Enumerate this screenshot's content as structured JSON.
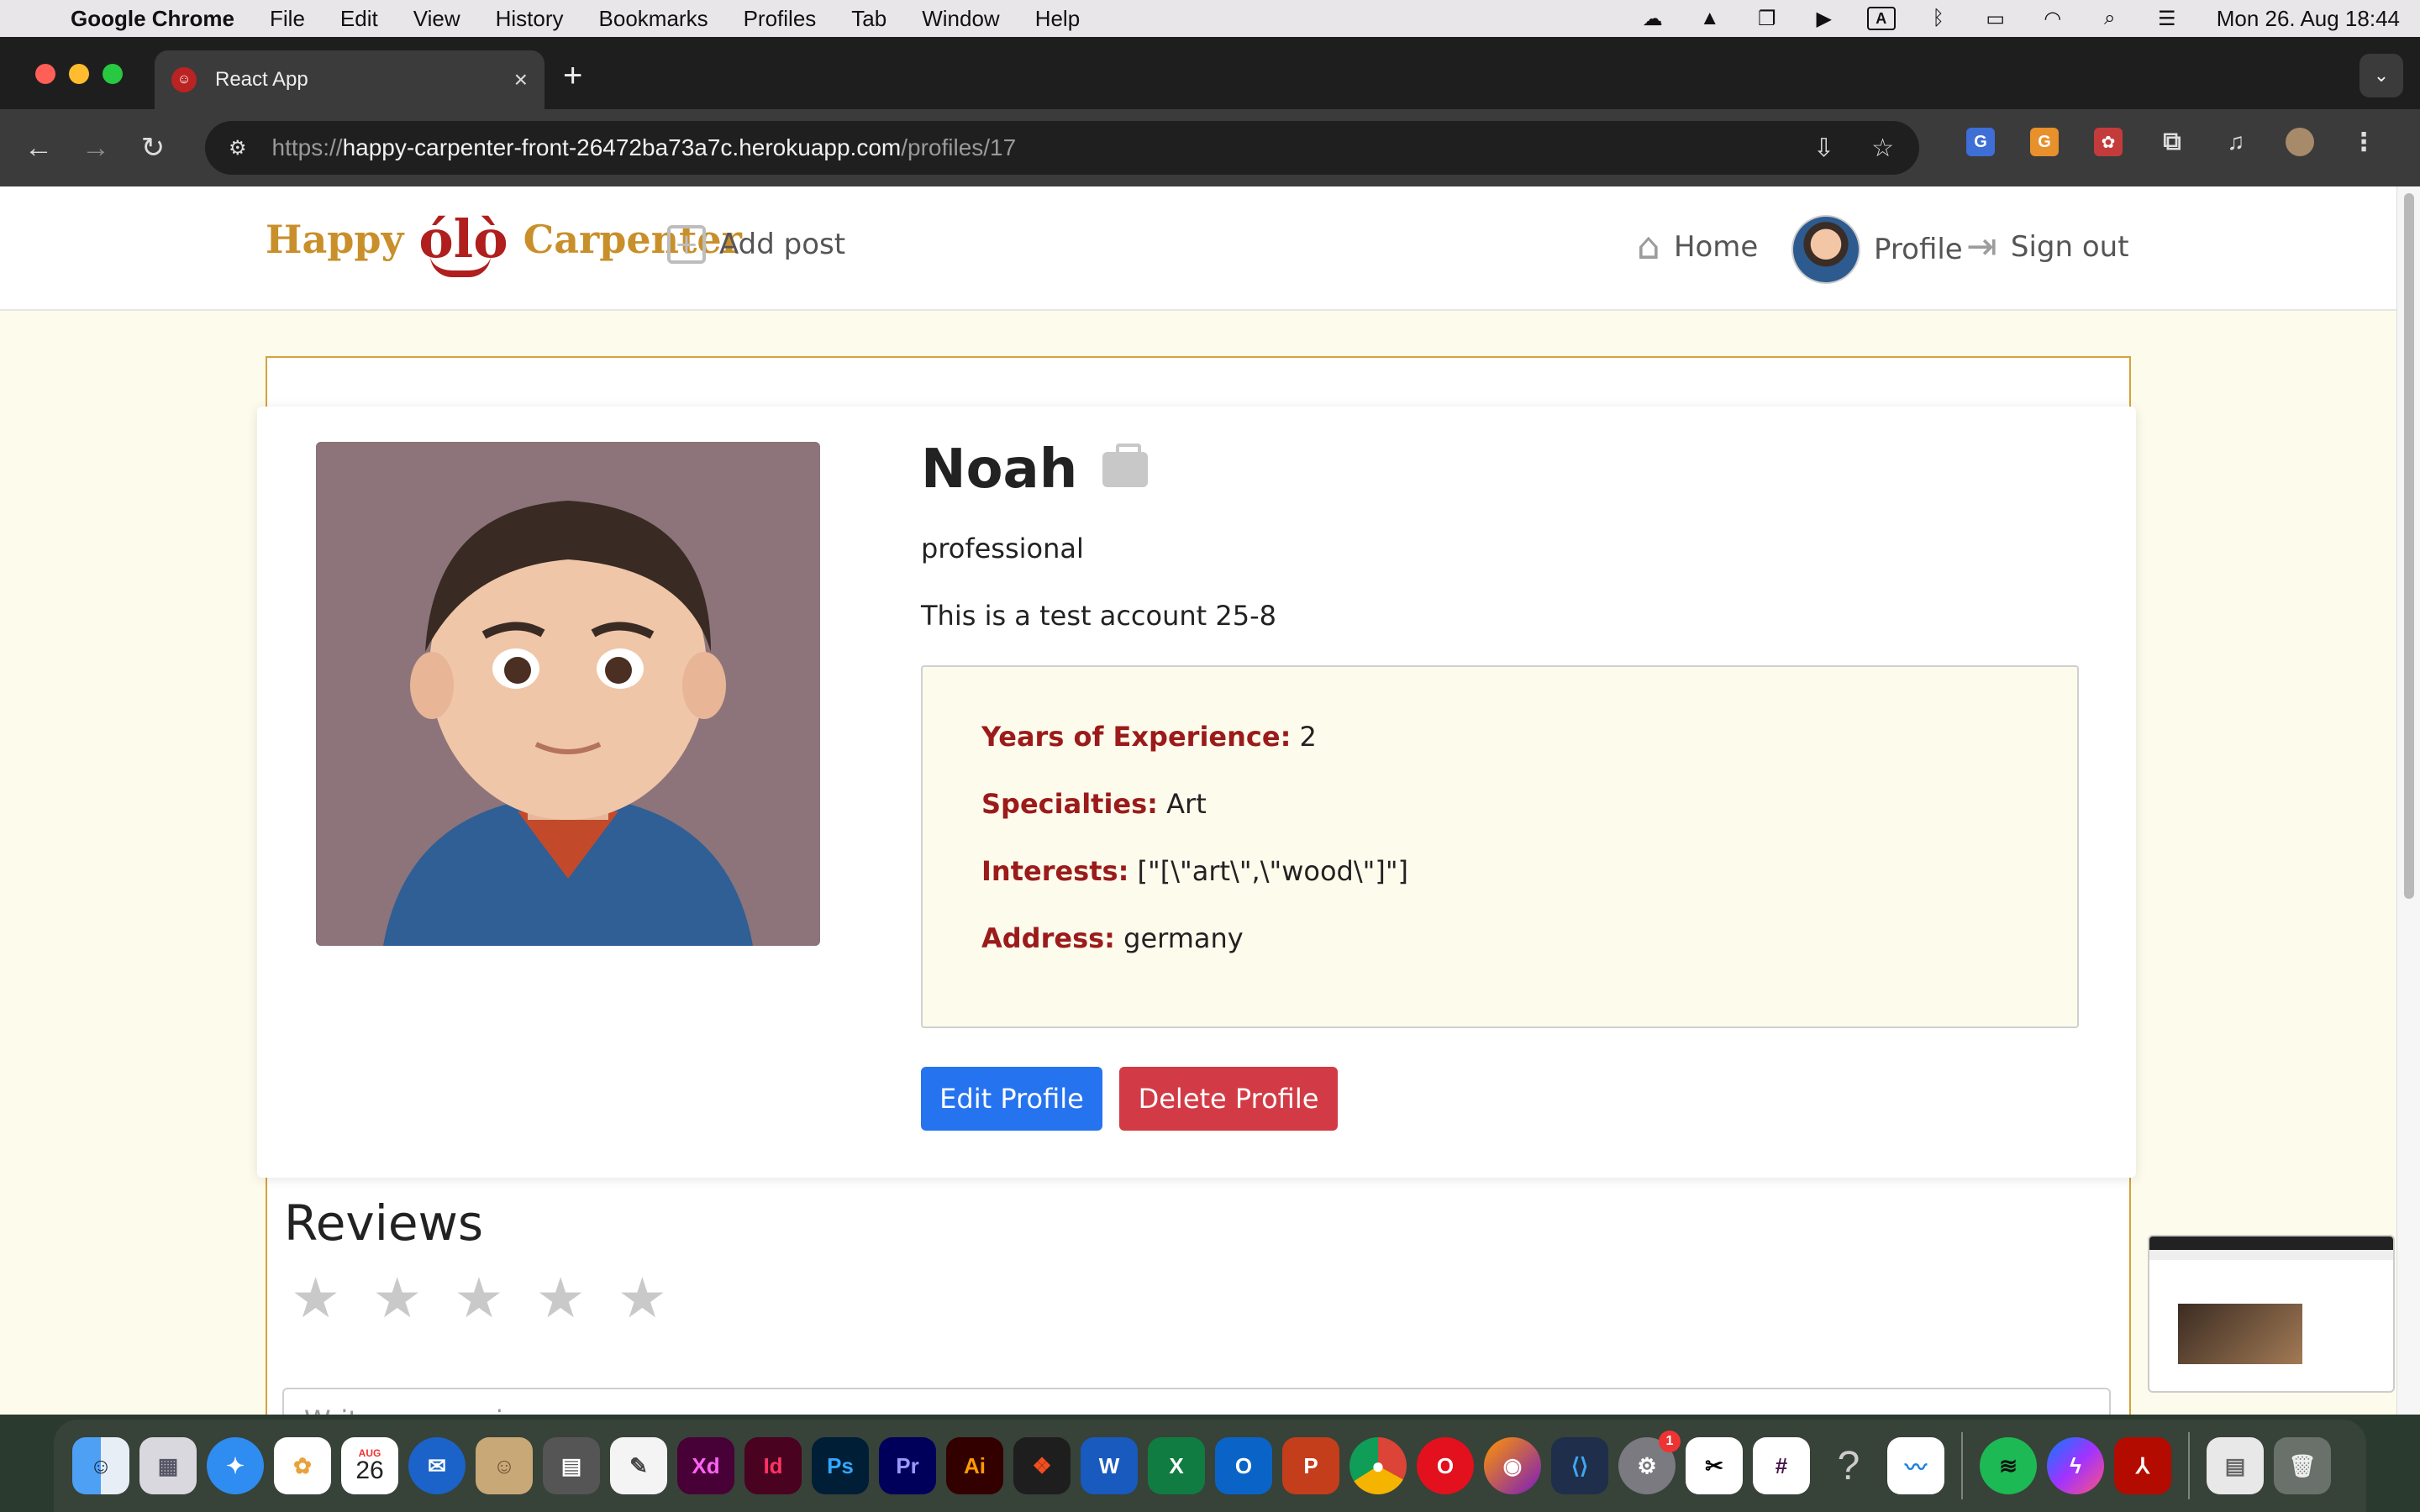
{
  "menubar": {
    "apple": "",
    "app_name": "Google Chrome",
    "items": [
      "File",
      "Edit",
      "View",
      "History",
      "Bookmarks",
      "Profiles",
      "Tab",
      "Window",
      "Help"
    ],
    "clock": "Mon 26. Aug  18:44"
  },
  "browser": {
    "tab_title": "React App",
    "url_scheme": "https://",
    "url_host": "happy-carpenter-front-26472ba73a7c.herokuapp.com",
    "url_path": "/profiles/17"
  },
  "site": {
    "logo_left": "Happy",
    "logo_mark": "ólò",
    "logo_right": "Carpenter",
    "nav": {
      "add_post": "Add post",
      "home": "Home",
      "profile": "Profile",
      "sign_out": "Sign out"
    }
  },
  "profile": {
    "name": "Noah",
    "role": "professional",
    "bio": "This is a test account 25-8",
    "details": [
      {
        "label": "Years of Experience:",
        "value": "2"
      },
      {
        "label": "Specialties:",
        "value": "Art"
      },
      {
        "label": "Interests:",
        "value": "[\"[\\\"art\\\",\\\"wood\\\"]\"]"
      },
      {
        "label": "Address:",
        "value": "germany"
      }
    ],
    "edit_label": "Edit Profile",
    "delete_label": "Delete Profile"
  },
  "reviews": {
    "title": "Reviews",
    "rating": 0,
    "max_rating": 5,
    "input_placeholder": "Write your review..."
  },
  "colors": {
    "brand_gold": "#c98f2a",
    "brand_red": "#b01e1e",
    "label_red": "#9b1b1b",
    "edit_blue": "#2673f0",
    "delete_red": "#d23b46",
    "page_bg": "#fdfbec"
  },
  "dock": {
    "icons": [
      "finder-icon",
      "launchpad-icon",
      "safari-icon",
      "photos-icon",
      "calendar-icon",
      "thunderbird-icon",
      "contacts-icon",
      "calculator-icon",
      "textedit-icon",
      "xd-icon",
      "indesign-icon",
      "photoshop-icon",
      "premiere-icon",
      "illustrator-icon",
      "figma-icon",
      "word-icon",
      "excel-icon",
      "outlook-icon",
      "powerpoint-icon",
      "chrome-icon",
      "opera-icon",
      "firefox-icon",
      "vscode-icon",
      "system-settings-icon",
      "capcut-icon",
      "slack-icon",
      "help-icon",
      "freeform-icon",
      "spotify-icon",
      "messenger-icon",
      "acrobat-icon",
      "documents-icon",
      "trash-icon"
    ],
    "calendar_month": "AUG",
    "calendar_day": "26",
    "settings_badge": "1"
  }
}
